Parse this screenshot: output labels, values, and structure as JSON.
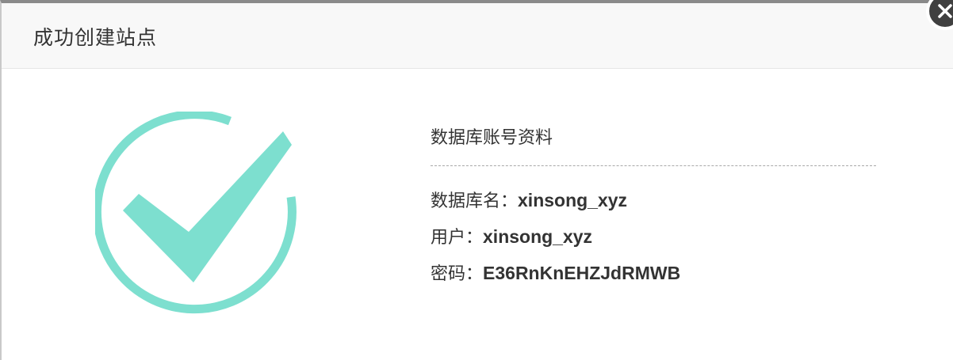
{
  "dialog": {
    "title": "成功创建站点",
    "close_icon": "close-icon"
  },
  "success": {
    "icon": "check-circle-icon",
    "color": "#7ddfcf"
  },
  "database": {
    "section_title": "数据库账号资料",
    "name_label": "数据库名：",
    "name_value": "xinsong_xyz",
    "user_label": "用户：",
    "user_value": "xinsong_xyz",
    "password_label": "密码：",
    "password_value": "E36RnKnEHZJdRMWB"
  }
}
